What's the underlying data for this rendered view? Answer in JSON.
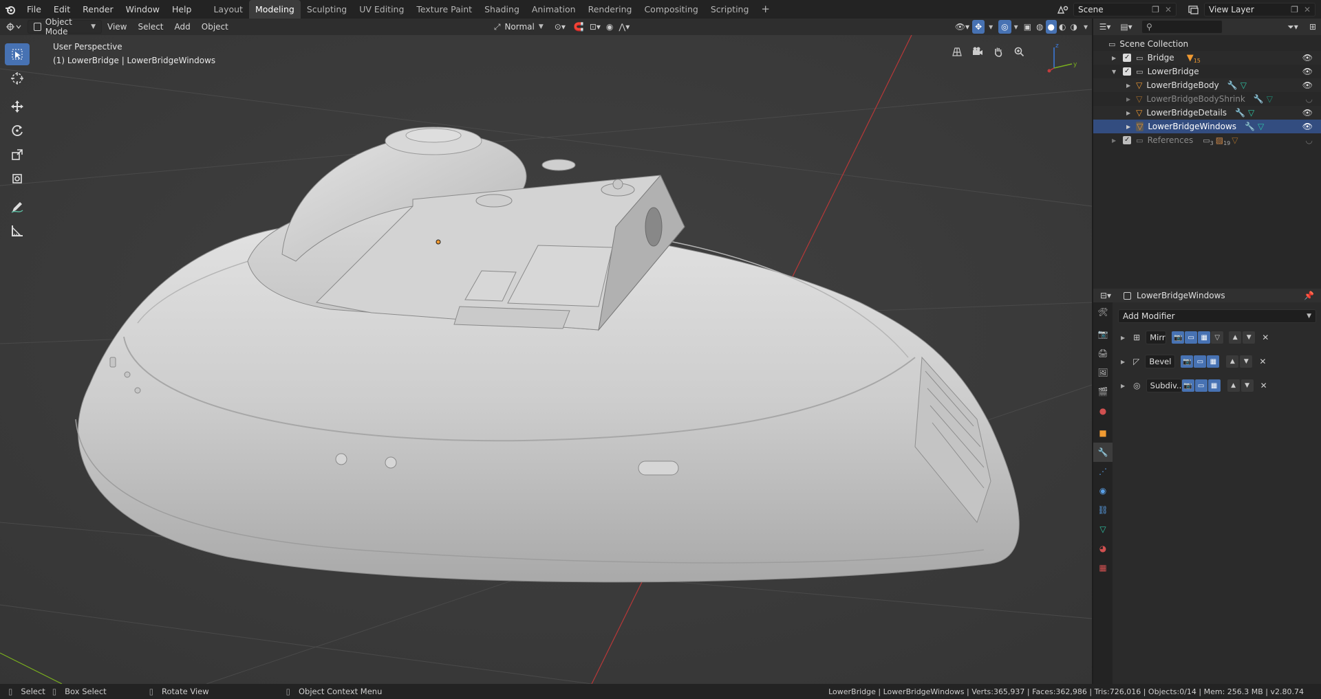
{
  "topbar": {
    "menus": [
      "File",
      "Edit",
      "Render",
      "Window",
      "Help"
    ],
    "workspaces": [
      "Layout",
      "Modeling",
      "Sculpting",
      "UV Editing",
      "Texture Paint",
      "Shading",
      "Animation",
      "Rendering",
      "Compositing",
      "Scripting"
    ],
    "active_workspace": "Modeling",
    "scene": "Scene",
    "view_layer": "View Layer"
  },
  "viewport_header": {
    "mode": "Object Mode",
    "menus": [
      "View",
      "Select",
      "Add",
      "Object"
    ],
    "orientation": "Normal"
  },
  "viewport": {
    "view_name": "User Perspective",
    "object_info": "(1) LowerBridge | LowerBridgeWindows",
    "gizmo_axes": [
      "z",
      "y",
      "x"
    ]
  },
  "outliner": {
    "root": "Scene Collection",
    "items": [
      {
        "label": "Bridge",
        "badge": "15",
        "level": 1,
        "selected": false,
        "dim": false
      },
      {
        "label": "LowerBridge",
        "level": 1,
        "selected": false,
        "dim": false
      },
      {
        "label": "LowerBridgeBody",
        "level": 2,
        "selected": false,
        "dim": false
      },
      {
        "label": "LowerBridgeBodyShrink",
        "level": 2,
        "selected": false,
        "dim": true
      },
      {
        "label": "LowerBridgeDetails",
        "level": 2,
        "selected": false,
        "dim": false
      },
      {
        "label": "LowerBridgeWindows",
        "level": 2,
        "selected": true,
        "dim": false
      },
      {
        "label": "References",
        "badge1": "3",
        "badge2": "19",
        "level": 1,
        "selected": false,
        "dim": true
      }
    ]
  },
  "properties": {
    "object_name": "LowerBridgeWindows",
    "add_modifier": "Add Modifier",
    "modifiers": [
      {
        "name": "Mirr",
        "icon": "mirror-icon"
      },
      {
        "name": "Bevel",
        "icon": "bevel-icon"
      },
      {
        "name": "Subdiv..",
        "icon": "subdivision-icon"
      }
    ]
  },
  "statusbar": {
    "select": "Select",
    "box_select": "Box Select",
    "rotate_view": "Rotate View",
    "context_menu": "Object Context Menu",
    "stats": "LowerBridge | LowerBridgeWindows | Verts:365,937 | Faces:362,986 | Tris:726,016 | Objects:0/14 | Mem: 256.3 MB | v2.80.74"
  },
  "colors": {
    "accent": "#4772b3",
    "selection": "#334d80",
    "x_axis": "#c23c3c",
    "y_axis": "#7ab01e",
    "z_axis": "#3b7ce0",
    "object_orange": "#f09a32",
    "mesh_teal": "#2ec5a6"
  }
}
